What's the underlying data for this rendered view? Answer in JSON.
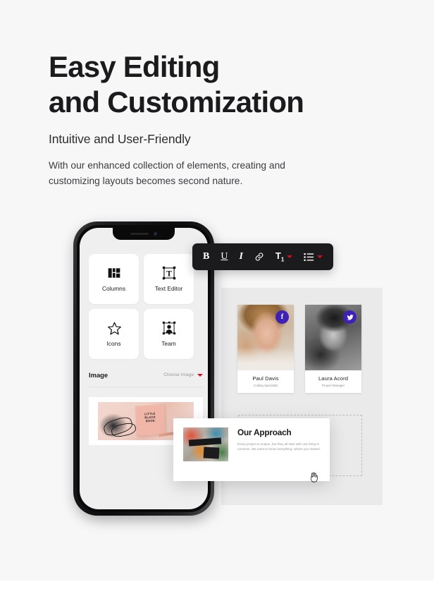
{
  "hero": {
    "headline": "Easy Editing\nand Customization",
    "subheadline": "Intuitive and User-Friendly",
    "body": "With our enhanced collection of elements, creating and\ncustomizing layouts becomes second nature."
  },
  "toolbar": {
    "bold_label": "B",
    "underline_label": "U",
    "italic_label": "I",
    "link_label": "link-icon",
    "text_size_label": "T",
    "text_size_sub": "1",
    "list_label": "list-icon"
  },
  "phone": {
    "widgets": [
      {
        "label": "Columns",
        "icon": "columns-icon"
      },
      {
        "label": "Text Editor",
        "icon": "text-editor-icon"
      },
      {
        "label": "Icons",
        "icon": "star-icon"
      },
      {
        "label": "Team",
        "icon": "team-icon"
      }
    ],
    "image_row": {
      "label": "Image",
      "choose_label": "Choose Image"
    },
    "preview_image_text": "LITTLE\nBLACK\nBOOK"
  },
  "team": [
    {
      "name": "Paul Davis",
      "role": "Coding Specialist",
      "social": "facebook",
      "social_glyph": "f"
    },
    {
      "name": "Laura Acord",
      "role": "Project Manager",
      "social": "twitter",
      "social_glyph": "t"
    }
  ],
  "approach": {
    "title": "Our Approach",
    "body": "Every project is unique, but they all start with one thing in common. We want to know everything: where you started."
  },
  "colors": {
    "page_background": "#f7f7f8",
    "canvas_panel": "#eaeaeb",
    "toolbar_background": "#1b1b1d",
    "accent_red": "#d1101f",
    "social_badge": "#3f21b8",
    "heading_text": "#1b1b1d"
  }
}
